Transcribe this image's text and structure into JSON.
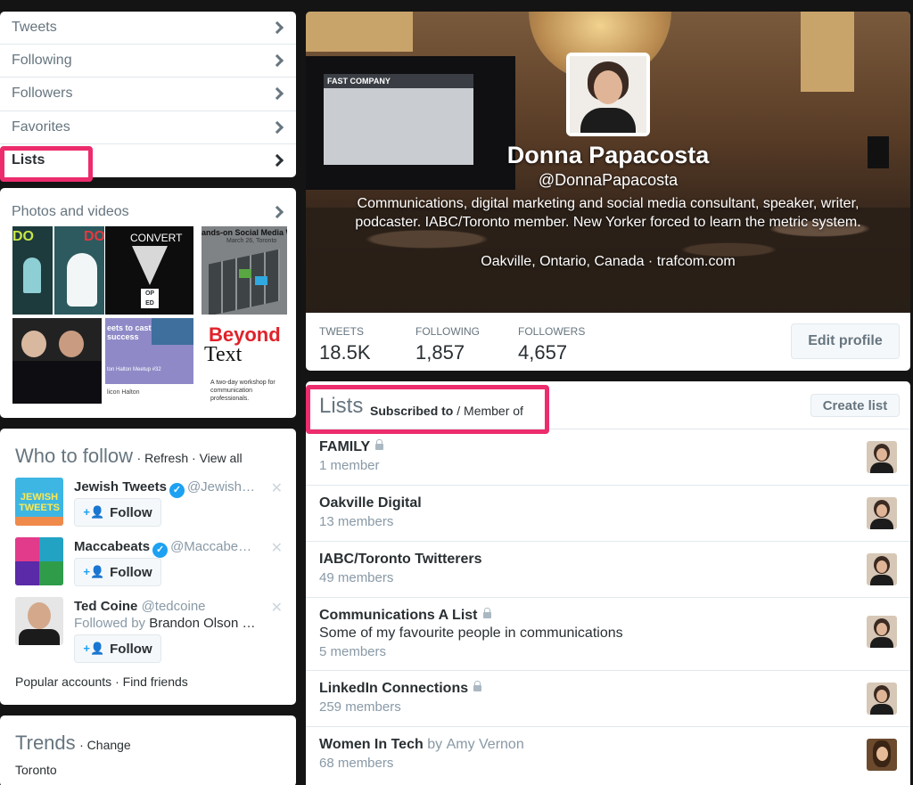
{
  "nav": {
    "items": [
      "Tweets",
      "Following",
      "Followers",
      "Favorites",
      "Lists"
    ]
  },
  "photos": {
    "title": "Photos and videos",
    "tiles": {
      "do1": "DO",
      "do2": "DO",
      "convert": "CONVERT",
      "workshop": "ands-on Social Media Worksh",
      "workshop_sub": "March 26, Toronto",
      "podcast": "eets to cast success",
      "meetup": "ton Halton Meetup #32",
      "silicon": "licon Halton",
      "beyond1": "Beyond",
      "beyond2": "Text",
      "beyond_sub": "A two-day workshop for communication professionals."
    }
  },
  "who_to_follow": {
    "title": "Who to follow",
    "refresh": "Refresh",
    "view_all": "View all",
    "follow_label": "Follow",
    "suggestions": [
      {
        "name": "Jewish Tweets",
        "handle": "@Jewish…",
        "verified": true,
        "avatar_text": "JEWISH TWEETS"
      },
      {
        "name": "Maccabeats",
        "handle": "@Maccabe…",
        "verified": true
      },
      {
        "name": "Ted Coine",
        "handle": "@tedcoine",
        "verified": false,
        "followed_by_prefix": "Followed by",
        "followed_by": "Brandon Olson …"
      }
    ],
    "footer_popular": "Popular accounts",
    "footer_find": "Find friends"
  },
  "trends": {
    "title": "Trends",
    "change": "Change",
    "location": "Toronto"
  },
  "profile": {
    "name": "Donna Papacosta",
    "handle": "@DonnaPapacosta",
    "bio": "Communications, digital marketing and social media consultant, speaker, writer, podcaster. IABC/Toronto member. New Yorker forced to learn the metric system.",
    "location": "Oakville, Ontario, Canada",
    "website": "trafcom.com",
    "cover_screen_text": "FAST COMPANY",
    "stats": [
      {
        "label": "TWEETS",
        "value": "18.5K"
      },
      {
        "label": "FOLLOWING",
        "value": "1,857"
      },
      {
        "label": "FOLLOWERS",
        "value": "4,657"
      }
    ],
    "edit_label": "Edit profile"
  },
  "lists": {
    "title": "Lists",
    "tab_subscribed": "Subscribed to",
    "tab_member": "Member of",
    "create_label": "Create list",
    "items": [
      {
        "name": "FAMILY",
        "locked": true,
        "count": "1 member"
      },
      {
        "name": "Oakville Digital",
        "locked": false,
        "count": "13 members"
      },
      {
        "name": "IABC/Toronto Twitterers",
        "locked": false,
        "count": "49 members"
      },
      {
        "name": "Communications A List",
        "locked": true,
        "desc": "Some of my favourite people in communications",
        "count": "5 members"
      },
      {
        "name": "LinkedIn Connections",
        "locked": true,
        "count": "259 members"
      },
      {
        "name": "Women In Tech",
        "locked": false,
        "by_prefix": "by",
        "by": "Amy Vernon",
        "count": "68 members"
      }
    ]
  },
  "colors": {
    "highlight": "#ec2c6c",
    "accent": "#1da1f2",
    "muted_text": "#66757f"
  }
}
